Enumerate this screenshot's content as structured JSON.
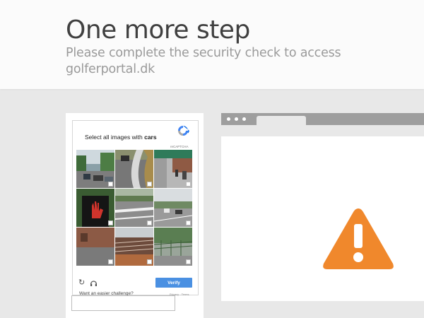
{
  "header": {
    "title": "One more step",
    "subtitle": "Please complete the security check to access golferportal.dk"
  },
  "captcha": {
    "prompt_prefix": "Select all images with ",
    "prompt_target": "cars",
    "brand_label": "reCAPTCHA",
    "verify_label": "Verify",
    "easier_label": "Want an easier challenge?",
    "privacy_label": "Privacy - Terms",
    "answer_value": "",
    "tiles": [
      {
        "name": "tile-street-cars"
      },
      {
        "name": "tile-road-curve"
      },
      {
        "name": "tile-sidewalk-houses"
      },
      {
        "name": "tile-pedestrian-signal"
      },
      {
        "name": "tile-road-crossing"
      },
      {
        "name": "tile-highway-cars"
      },
      {
        "name": "tile-brick-building"
      },
      {
        "name": "tile-bridge-fence"
      },
      {
        "name": "tile-green-fence"
      }
    ]
  },
  "colors": {
    "accent": "#4a90e2",
    "warning": "#f0882c"
  },
  "icons": {
    "reload": "reload-icon",
    "audio": "headphones-icon",
    "warning": "warning-icon"
  }
}
